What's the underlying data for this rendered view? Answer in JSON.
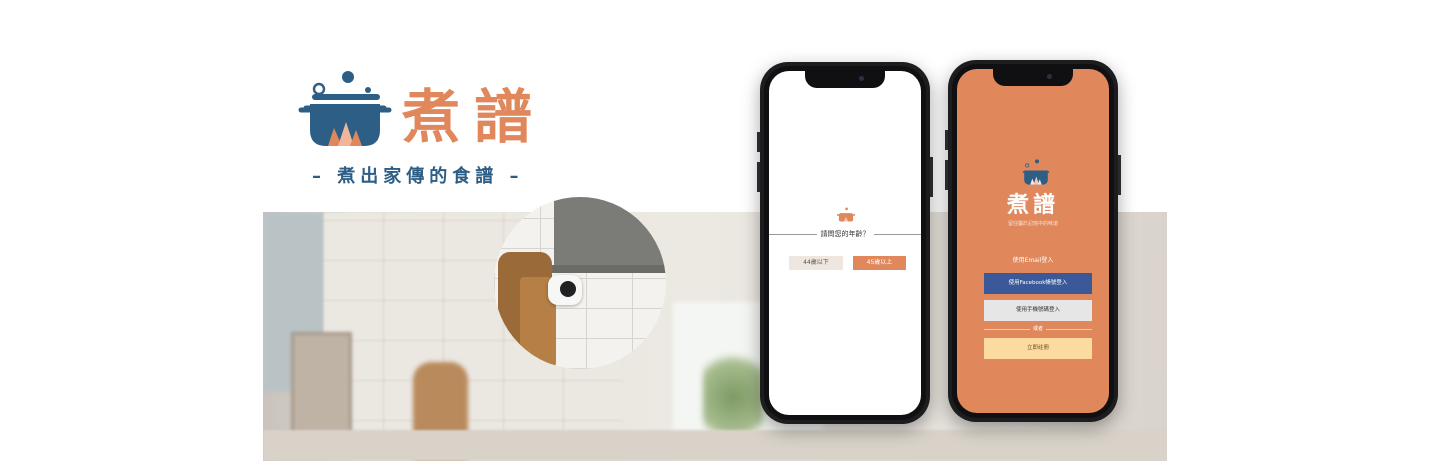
{
  "colors": {
    "brand_orange": "#e0875b",
    "brand_blue": "#2d5e86",
    "facebook_blue": "#3b5998",
    "register_yellow": "#fbdba0"
  },
  "logo": {
    "name": "煮譜",
    "slogan": "– 煮出家傳的食譜 –",
    "icon": "cooking-pot-icon"
  },
  "phone_age_screen": {
    "question": "請問您的年齡？",
    "option_under": "44歲以下",
    "option_over": "45歲以上"
  },
  "phone_login_screen": {
    "brand": "煮譜",
    "subtitle": "留住屬於記憶中的味道",
    "email_login": "使用Email登入",
    "facebook_login": "使用Facebook帳號登入",
    "phone_login": "使用手機號碼登入",
    "or_label": "或者",
    "register": "立即註冊"
  }
}
